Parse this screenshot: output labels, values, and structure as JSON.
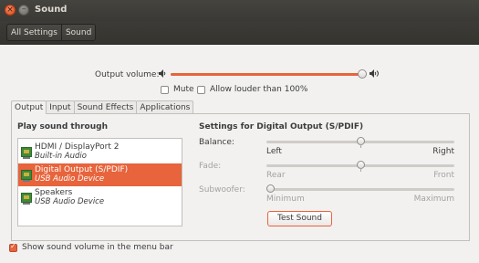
{
  "window": {
    "title": "Sound",
    "close_glyph": "×",
    "min_glyph": "–"
  },
  "toolbar": {
    "crumbs": [
      "All Settings",
      "Sound"
    ]
  },
  "volume": {
    "label": "Output volume:",
    "level": 0.98,
    "low_icon": "speaker-low-icon",
    "high_icon": "speaker-high-icon",
    "mute_label": "Mute",
    "mute_checked": false,
    "louder_label": "Allow louder than 100%",
    "louder_checked": false
  },
  "tabs": [
    "Output",
    "Input",
    "Sound Effects",
    "Applications"
  ],
  "active_tab": "Output",
  "output": {
    "play_through_heading": "Play sound through",
    "devices": [
      {
        "name": "HDMI / DisplayPort 2",
        "sub": "Built-in Audio",
        "selected": false
      },
      {
        "name": "Digital Output (S/PDIF)",
        "sub": "USB Audio Device",
        "selected": true
      },
      {
        "name": "Speakers",
        "sub": "USB Audio Device",
        "selected": false
      }
    ],
    "settings_heading": "Settings for Digital Output (S/PDIF)",
    "balance": {
      "label": "Balance:",
      "left": "Left",
      "right": "Right",
      "value": 0.5
    },
    "fade": {
      "label": "Fade:",
      "left": "Rear",
      "right": "Front",
      "value": 0.5
    },
    "subwoofer": {
      "label": "Subwoofer:",
      "left": "Minimum",
      "right": "Maximum",
      "value": 0
    },
    "test_button": "Test Sound"
  },
  "menu_bar_option": {
    "label": "Show sound volume in the menu bar",
    "checked": true
  },
  "colors": {
    "accent": "#e7643c",
    "titlebar": "#3c3b37",
    "background": "#f2f1f0"
  }
}
